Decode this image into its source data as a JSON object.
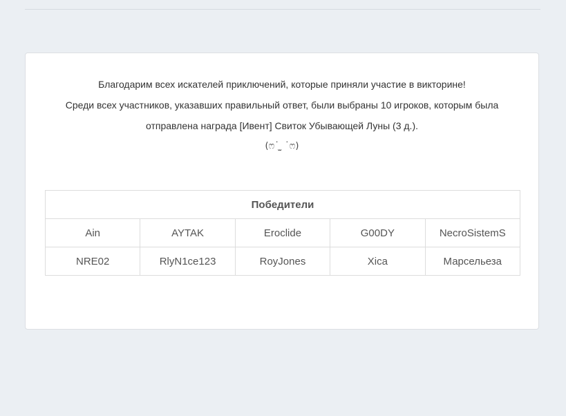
{
  "announcement": {
    "line1": "Благодарим всех искателей приключений, которые приняли участие в викторине!",
    "line2": "Среди всех участников, указавших правильный ответ, были выбраны 10 игроков, которым была",
    "line3": "отправлена награда [Ивент] Свиток Убывающей Луны (3 д.).",
    "emoticon": "(ෆ˙ ̫ ˙ෆ)"
  },
  "winners": {
    "header": "Победители",
    "rows": [
      [
        "Ain",
        "AYTAK",
        "Eroclide",
        "G00DY",
        "NecroSistemS"
      ],
      [
        "NRE02",
        "RlyN1ce123",
        "RoyJones",
        "Xica",
        "Марсельеза"
      ]
    ]
  }
}
